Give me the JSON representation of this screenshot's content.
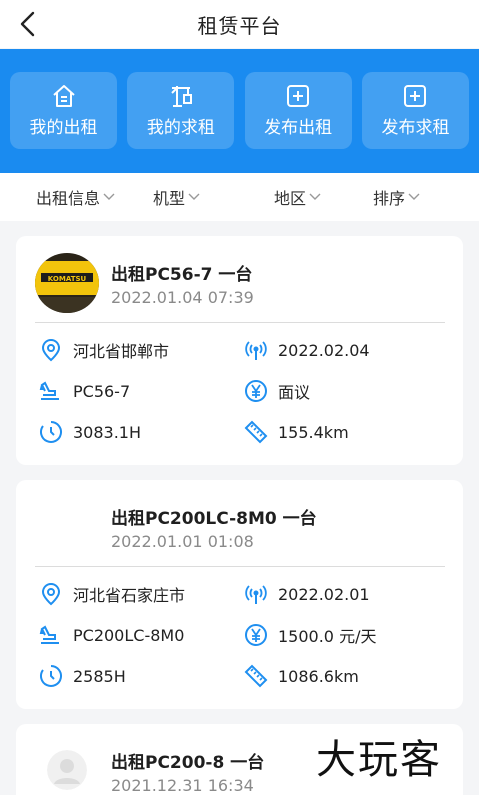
{
  "header": {
    "title": "租赁平台",
    "back_icon": "chevron-left-icon"
  },
  "actions": [
    {
      "label": "我的出租",
      "icon": "house-icon"
    },
    {
      "label": "我的求租",
      "icon": "crane-icon"
    },
    {
      "label": "发布出租",
      "icon": "plus-square-icon"
    },
    {
      "label": "发布求租",
      "icon": "plus-square-icon"
    }
  ],
  "filters": [
    {
      "label": "出租信息"
    },
    {
      "label": "机型"
    },
    {
      "label": "地区"
    },
    {
      "label": "排序"
    }
  ],
  "listings": [
    {
      "title": "出租PC56-7 一台",
      "time": "2022.01.04 07:39",
      "location": "河北省邯郸市",
      "date": "2022.02.04",
      "model": "PC56-7",
      "price": "面议",
      "hours": "3083.1H",
      "distance": "155.4km",
      "thumb": "excavator-photo"
    },
    {
      "title": "出租PC200LC-8M0 一台",
      "time": "2022.01.01 01:08",
      "location": "河北省石家庄市",
      "date": "2022.02.01",
      "model": "PC200LC-8M0",
      "price": "1500.0 元/天",
      "hours": "2585H",
      "distance": "1086.6km",
      "thumb": "none"
    },
    {
      "title": "出租PC200-8 一台",
      "time": "2021.12.31 16:34",
      "thumb": "avatar-placeholder"
    }
  ],
  "watermark": {
    "text": "大玩客",
    "logo_text": "KOMATSU"
  },
  "colors": {
    "primary": "#1a8bf0",
    "icon_blue": "#1f8ff0"
  }
}
